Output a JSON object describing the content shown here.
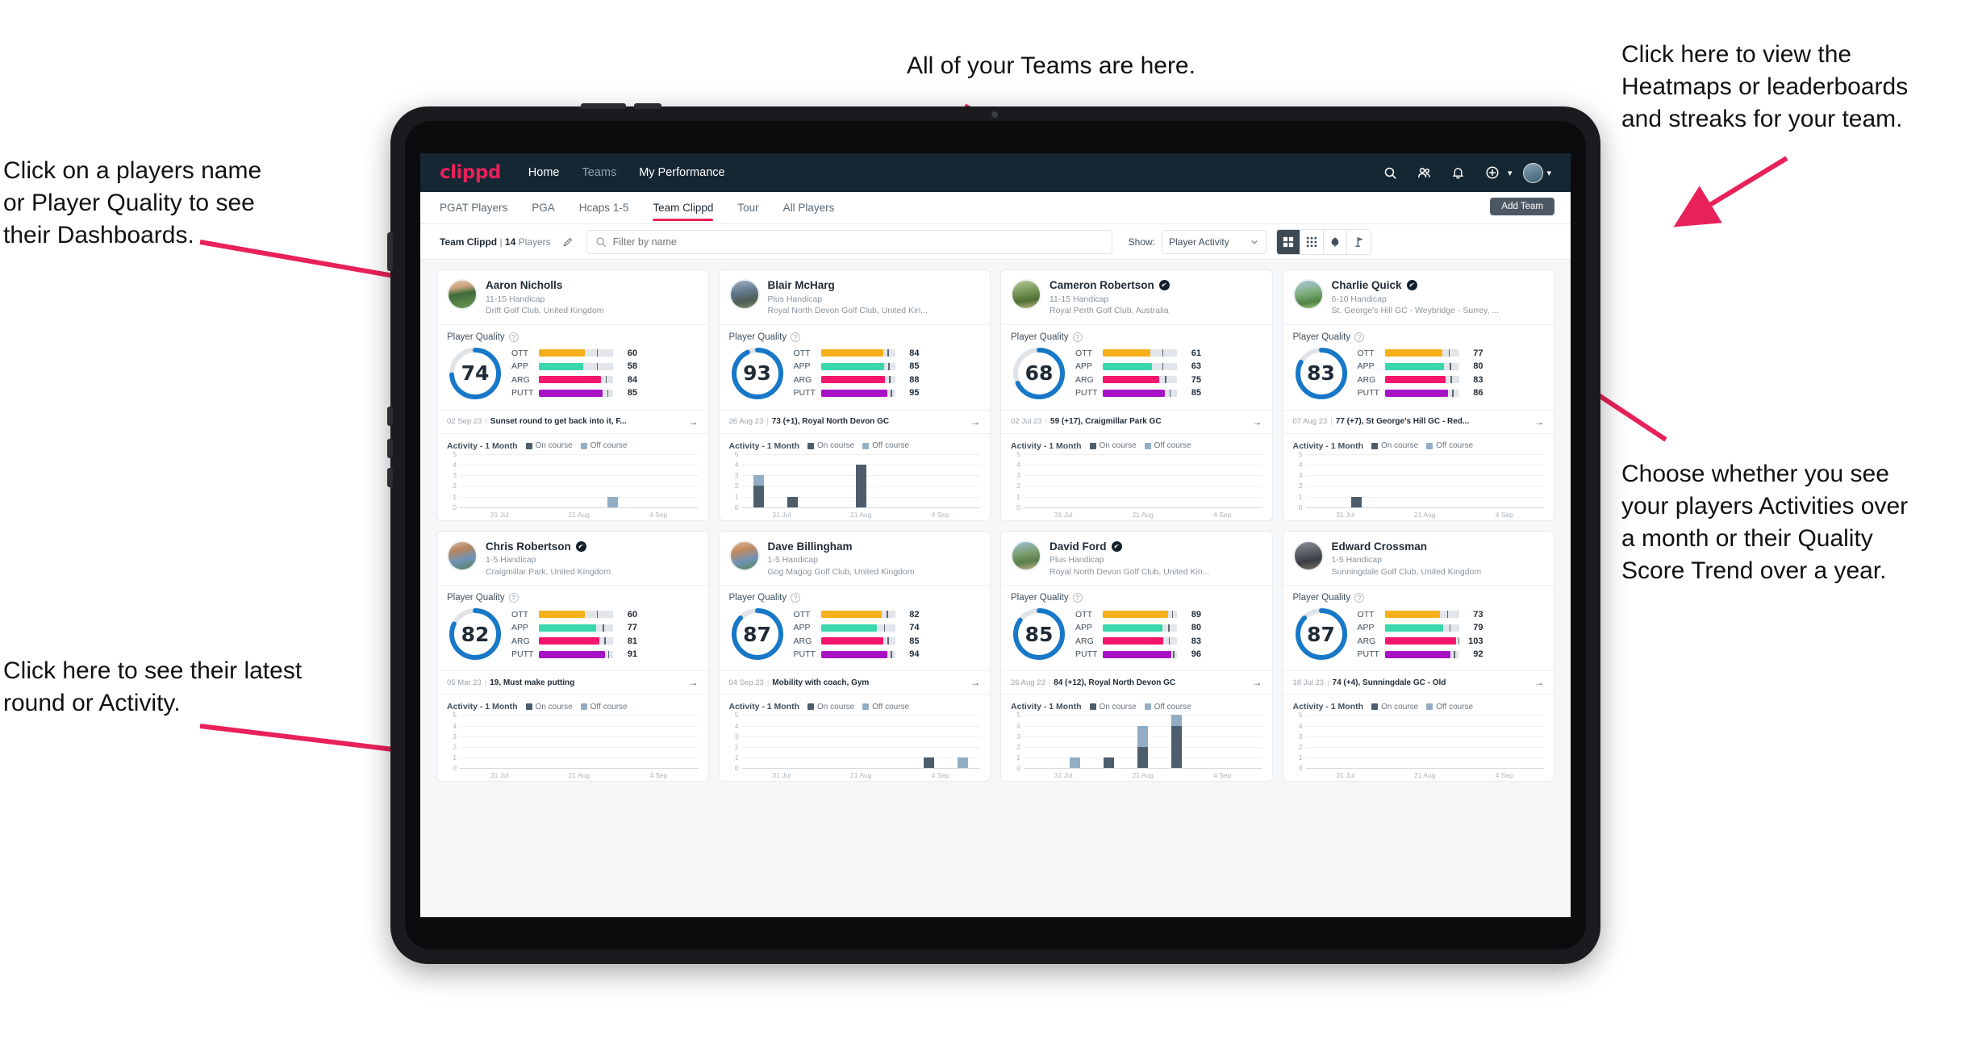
{
  "annotations": {
    "teams": "All of your Teams are here.",
    "heatmaps": "Click here to view the\nHeatmaps or leaderboards\nand streaks for your team.",
    "players": "Click on a players name\nor Player Quality to see\ntheir Dashboards.",
    "choose": "Choose whether you see\nyour players Activities over\na month or their Quality\nScore Trend over a year.",
    "latest": "Click here to see their latest\nround or Activity."
  },
  "topnav": {
    "brand": "clippd",
    "links": [
      {
        "label": "Home",
        "active": true
      },
      {
        "label": "Teams",
        "active": false
      },
      {
        "label": "My Performance",
        "active": true
      }
    ],
    "icons": [
      "search-icon",
      "people-icon",
      "bell-icon",
      "plus-circle-icon"
    ]
  },
  "tabs": [
    {
      "label": "PGAT Players",
      "active": false
    },
    {
      "label": "PGA",
      "active": false
    },
    {
      "label": "Hcaps 1-5",
      "active": false
    },
    {
      "label": "Team Clippd",
      "active": true
    },
    {
      "label": "Tour",
      "active": false
    },
    {
      "label": "All Players",
      "active": false
    }
  ],
  "add_team_label": "Add Team",
  "toolbar": {
    "team_name": "Team Clippd",
    "team_separator": "|",
    "player_count": "14",
    "players_word": "Players",
    "search_placeholder": "Filter by name",
    "show_label": "Show:",
    "show_value": "Player Activity",
    "view_modes": [
      "large-grid-icon",
      "small-grid-icon",
      "heatmap-icon",
      "leaderboard-icon"
    ],
    "active_view": 0
  },
  "colors": {
    "brand_pink": "#e8215a",
    "nav_bg": "#152733",
    "gauge_blue": "#1878c8",
    "ott": "#f5b01a",
    "app": "#3ad6ac",
    "arg": "#f4156d",
    "putt": "#a713c4",
    "on_course": "#4d5d6b",
    "off_course": "#93aec4",
    "annotation_arrow": "#e8215a"
  },
  "chart_common": {
    "title": "Activity - 1 Month",
    "legend": [
      {
        "label": "On course",
        "color": "#4d5d6b"
      },
      {
        "label": "Off course",
        "color": "#93aec4"
      }
    ],
    "yticks": [
      "5",
      "4",
      "3",
      "2",
      "1",
      "0"
    ],
    "ylim": [
      0,
      5
    ],
    "xlabels": [
      "31 Jul",
      "21 Aug",
      "4 Sep"
    ],
    "bins": 7
  },
  "metric_labels": [
    "OTT",
    "APP",
    "ARG",
    "PUTT"
  ],
  "player_quality_label": "Player Quality",
  "players": [
    {
      "name": "Aaron Nicholls",
      "verified": false,
      "handicap": "11-15 Handicap",
      "club": "Drift Golf Club, United Kingdom",
      "quality": 74,
      "metrics": [
        {
          "label": "OTT",
          "value": 60,
          "fill": 62,
          "tick": 78,
          "color": "#f5b01a"
        },
        {
          "label": "APP",
          "value": 58,
          "fill": 60,
          "tick": 78,
          "color": "#3ad6ac"
        },
        {
          "label": "ARG",
          "value": 84,
          "fill": 84,
          "tick": 90,
          "color": "#f4156d"
        },
        {
          "label": "PUTT",
          "value": 85,
          "fill": 86,
          "tick": 92,
          "color": "#a713c4"
        }
      ],
      "round": {
        "date": "02 Sep 23",
        "text": "Sunset round to get back into it, F..."
      },
      "chart": {
        "type": "bar",
        "on": [
          0,
          0,
          0,
          0,
          0,
          0,
          0
        ],
        "off": [
          0,
          0,
          0,
          0,
          1,
          0,
          0
        ]
      }
    },
    {
      "name": "Blair McHarg",
      "verified": false,
      "handicap": "Plus Handicap",
      "club": "Royal North Devon Golf Club, United Kin...",
      "quality": 93,
      "metrics": [
        {
          "label": "OTT",
          "value": 84,
          "fill": 84,
          "tick": 90,
          "color": "#f5b01a"
        },
        {
          "label": "APP",
          "value": 85,
          "fill": 85,
          "tick": 91,
          "color": "#3ad6ac"
        },
        {
          "label": "ARG",
          "value": 88,
          "fill": 86,
          "tick": 92,
          "color": "#f4156d"
        },
        {
          "label": "PUTT",
          "value": 95,
          "fill": 90,
          "tick": 94,
          "color": "#a713c4"
        }
      ],
      "round": {
        "date": "26 Aug 23",
        "text": "73 (+1), Royal North Devon GC"
      },
      "chart": {
        "type": "bar",
        "on": [
          2,
          1,
          0,
          4,
          0,
          0,
          0
        ],
        "off": [
          1,
          0,
          0,
          0,
          0,
          0,
          0
        ]
      }
    },
    {
      "name": "Cameron Robertson",
      "verified": true,
      "handicap": "11-15 Handicap",
      "club": "Royal Perth Golf Club, Australia",
      "quality": 68,
      "metrics": [
        {
          "label": "OTT",
          "value": 61,
          "fill": 64,
          "tick": 80,
          "color": "#f5b01a"
        },
        {
          "label": "APP",
          "value": 63,
          "fill": 66,
          "tick": 80,
          "color": "#3ad6ac"
        },
        {
          "label": "ARG",
          "value": 75,
          "fill": 76,
          "tick": 84,
          "color": "#f4156d"
        },
        {
          "label": "PUTT",
          "value": 85,
          "fill": 84,
          "tick": 90,
          "color": "#a713c4"
        }
      ],
      "round": {
        "date": "02 Jul 23",
        "text": "59 (+17), Craigmillar Park GC"
      },
      "chart": {
        "type": "bar",
        "on": [
          0,
          0,
          0,
          0,
          0,
          0,
          0
        ],
        "off": [
          0,
          0,
          0,
          0,
          0,
          0,
          0
        ]
      }
    },
    {
      "name": "Charlie Quick",
      "verified": true,
      "handicap": "6-10 Handicap",
      "club": "St. George's Hill GC - Weybridge - Surrey, ...",
      "quality": 83,
      "metrics": [
        {
          "label": "OTT",
          "value": 77,
          "fill": 78,
          "tick": 86,
          "color": "#f5b01a"
        },
        {
          "label": "APP",
          "value": 80,
          "fill": 80,
          "tick": 88,
          "color": "#3ad6ac"
        },
        {
          "label": "ARG",
          "value": 83,
          "fill": 82,
          "tick": 89,
          "color": "#f4156d"
        },
        {
          "label": "PUTT",
          "value": 86,
          "fill": 85,
          "tick": 91,
          "color": "#a713c4"
        }
      ],
      "round": {
        "date": "07 Aug 23",
        "text": "77 (+7), St George's Hill GC - Red..."
      },
      "chart": {
        "type": "bar",
        "on": [
          0,
          1,
          0,
          0,
          0,
          0,
          0
        ],
        "off": [
          0,
          0,
          0,
          0,
          0,
          0,
          0
        ]
      }
    },
    {
      "name": "Chris Robertson",
      "verified": true,
      "handicap": "1-5 Handicap",
      "club": "Craigmillar Park, United Kingdom",
      "quality": 82,
      "metrics": [
        {
          "label": "OTT",
          "value": 60,
          "fill": 62,
          "tick": 78,
          "color": "#f5b01a"
        },
        {
          "label": "APP",
          "value": 77,
          "fill": 77,
          "tick": 86,
          "color": "#3ad6ac"
        },
        {
          "label": "ARG",
          "value": 81,
          "fill": 81,
          "tick": 88,
          "color": "#f4156d"
        },
        {
          "label": "PUTT",
          "value": 91,
          "fill": 89,
          "tick": 93,
          "color": "#a713c4"
        }
      ],
      "round": {
        "date": "05 Mar 23",
        "text": "19, Must make putting"
      },
      "chart": {
        "type": "bar",
        "on": [
          0,
          0,
          0,
          0,
          0,
          0,
          0
        ],
        "off": [
          0,
          0,
          0,
          0,
          0,
          0,
          0
        ]
      }
    },
    {
      "name": "Dave Billingham",
      "verified": false,
      "handicap": "1-5 Handicap",
      "club": "Gog Magog Golf Club, United Kingdom",
      "quality": 87,
      "metrics": [
        {
          "label": "OTT",
          "value": 82,
          "fill": 82,
          "tick": 89,
          "color": "#f5b01a"
        },
        {
          "label": "APP",
          "value": 74,
          "fill": 75,
          "tick": 85,
          "color": "#3ad6ac"
        },
        {
          "label": "ARG",
          "value": 85,
          "fill": 84,
          "tick": 90,
          "color": "#f4156d"
        },
        {
          "label": "PUTT",
          "value": 94,
          "fill": 90,
          "tick": 94,
          "color": "#a713c4"
        }
      ],
      "round": {
        "date": "04 Sep 23",
        "text": "Mobility with coach, Gym"
      },
      "chart": {
        "type": "bar",
        "on": [
          0,
          0,
          0,
          0,
          0,
          1,
          0
        ],
        "off": [
          0,
          0,
          0,
          0,
          0,
          0,
          1
        ]
      }
    },
    {
      "name": "David Ford",
      "verified": true,
      "handicap": "Plus Handicap",
      "club": "Royal North Devon Golf Club, United Kin...",
      "quality": 85,
      "metrics": [
        {
          "label": "OTT",
          "value": 89,
          "fill": 88,
          "tick": 93,
          "color": "#f5b01a"
        },
        {
          "label": "APP",
          "value": 80,
          "fill": 80,
          "tick": 88,
          "color": "#3ad6ac"
        },
        {
          "label": "ARG",
          "value": 83,
          "fill": 82,
          "tick": 89,
          "color": "#f4156d"
        },
        {
          "label": "PUTT",
          "value": 96,
          "fill": 92,
          "tick": 95,
          "color": "#a713c4"
        }
      ],
      "round": {
        "date": "26 Aug 23",
        "text": "84 (+12), Royal North Devon GC"
      },
      "chart": {
        "type": "bar",
        "on": [
          0,
          0,
          1,
          2,
          4,
          0,
          0
        ],
        "off": [
          0,
          1,
          0,
          2,
          1,
          0,
          0
        ]
      }
    },
    {
      "name": "Edward Crossman",
      "verified": false,
      "handicap": "1-5 Handicap",
      "club": "Sunningdale Golf Club, United Kingdom",
      "quality": 87,
      "metrics": [
        {
          "label": "OTT",
          "value": 73,
          "fill": 74,
          "tick": 84,
          "color": "#f5b01a"
        },
        {
          "label": "APP",
          "value": 79,
          "fill": 79,
          "tick": 87,
          "color": "#3ad6ac"
        },
        {
          "label": "ARG",
          "value": 103,
          "fill": 96,
          "tick": 99,
          "color": "#f4156d"
        },
        {
          "label": "PUTT",
          "value": 92,
          "fill": 89,
          "tick": 93,
          "color": "#a713c4"
        }
      ],
      "round": {
        "date": "18 Jul 23",
        "text": "74 (+4), Sunningdale GC - Old"
      },
      "chart": {
        "type": "bar",
        "on": [
          0,
          0,
          0,
          0,
          0,
          0,
          0
        ],
        "off": [
          0,
          0,
          0,
          0,
          0,
          0,
          0
        ]
      }
    }
  ]
}
